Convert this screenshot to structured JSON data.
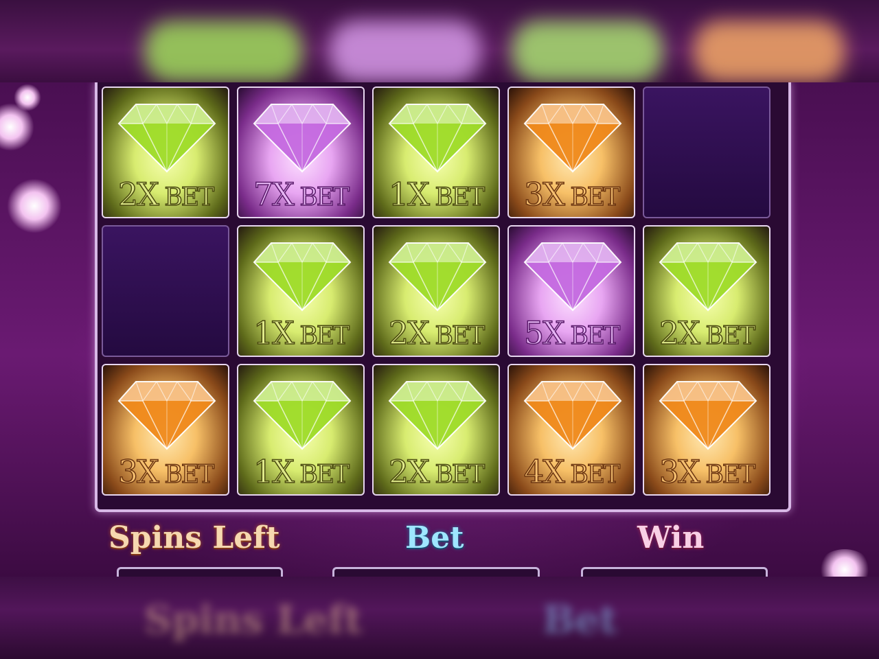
{
  "grid": {
    "rows": [
      [
        {
          "color": "green",
          "mult": "2X",
          "unit": "BET"
        },
        {
          "color": "purple",
          "mult": "7X",
          "unit": "BET"
        },
        {
          "color": "green",
          "mult": "1X",
          "unit": "BET"
        },
        {
          "color": "orange",
          "mult": "3X",
          "unit": "BET"
        },
        {
          "color": "empty"
        }
      ],
      [
        {
          "color": "empty"
        },
        {
          "color": "green",
          "mult": "1X",
          "unit": "BET"
        },
        {
          "color": "green",
          "mult": "2X",
          "unit": "BET"
        },
        {
          "color": "purple",
          "mult": "5X",
          "unit": "BET"
        },
        {
          "color": "green",
          "mult": "2X",
          "unit": "BET"
        }
      ],
      [
        {
          "color": "orange",
          "mult": "3X",
          "unit": "BET"
        },
        {
          "color": "green",
          "mult": "1X",
          "unit": "BET"
        },
        {
          "color": "green",
          "mult": "2X",
          "unit": "BET"
        },
        {
          "color": "orange",
          "mult": "4X",
          "unit": "BET"
        },
        {
          "color": "orange",
          "mult": "3X",
          "unit": "BET"
        }
      ]
    ]
  },
  "hud": {
    "spins_left_label": "Spins Left",
    "bet_label": "Bet",
    "win_label": "Win"
  },
  "gem_colors": {
    "green": "#9fdc2a",
    "purple": "#c46ae0",
    "orange": "#f08a1c"
  }
}
